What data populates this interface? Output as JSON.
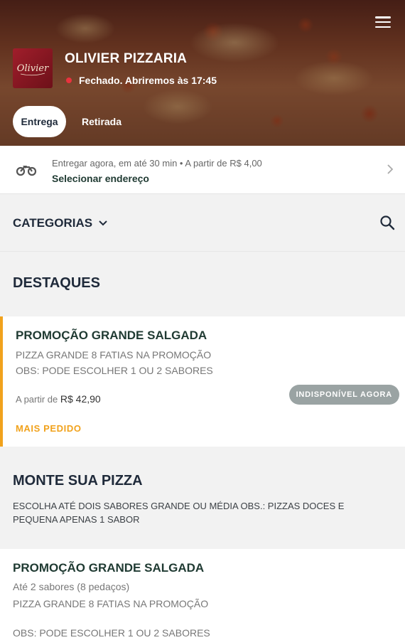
{
  "header": {
    "store_name": "OLIVIER PIZZARIA",
    "logo_text": "Olivier",
    "status_text": "Fechado. Abriremos às 17:45",
    "status_color": "#e8323e",
    "tabs": [
      {
        "label": "Entrega",
        "active": true
      },
      {
        "label": "Retirada",
        "active": false
      }
    ]
  },
  "delivery": {
    "info": "Entregar agora, em até 30 min  •  A partir de R$ 4,00",
    "action": "Selecionar endereço",
    "icon": "motorcycle-icon"
  },
  "categories": {
    "label": "CATEGORIAS",
    "icon": "chevron-down-icon",
    "search_icon": "search-icon"
  },
  "destaques": {
    "title": "DESTAQUES",
    "card": {
      "title": "PROMOÇÃO GRANDE SALGADA",
      "description": "PIZZA GRANDE 8 FATIAS NA PROMOÇÃO\nOBS: PODE ESCOLHER 1 OU 2 SABORES",
      "price_prefix": "A partir de",
      "price": "R$ 42,90",
      "badge": "INDISPONÍVEL AGORA",
      "tag": "MAIS PEDIDO",
      "accent_color": "#f1a21c"
    }
  },
  "monte": {
    "title": "MONTE SUA PIZZA",
    "description": "ESCOLHA ATÉ DOIS SABORES GRANDE OU MÉDIA OBS.: PIZZAS DOCES E PEQUENA APENAS 1 SABOR",
    "item": {
      "title": "PROMOÇÃO GRANDE SALGADA",
      "subtitle": "Até 2 sabores (8 pedaços)",
      "description": "PIZZA GRANDE 8 FATIAS NA PROMOÇÃO",
      "obs": "OBS: PODE ESCOLHER 1 OU 2 SABORES"
    }
  }
}
